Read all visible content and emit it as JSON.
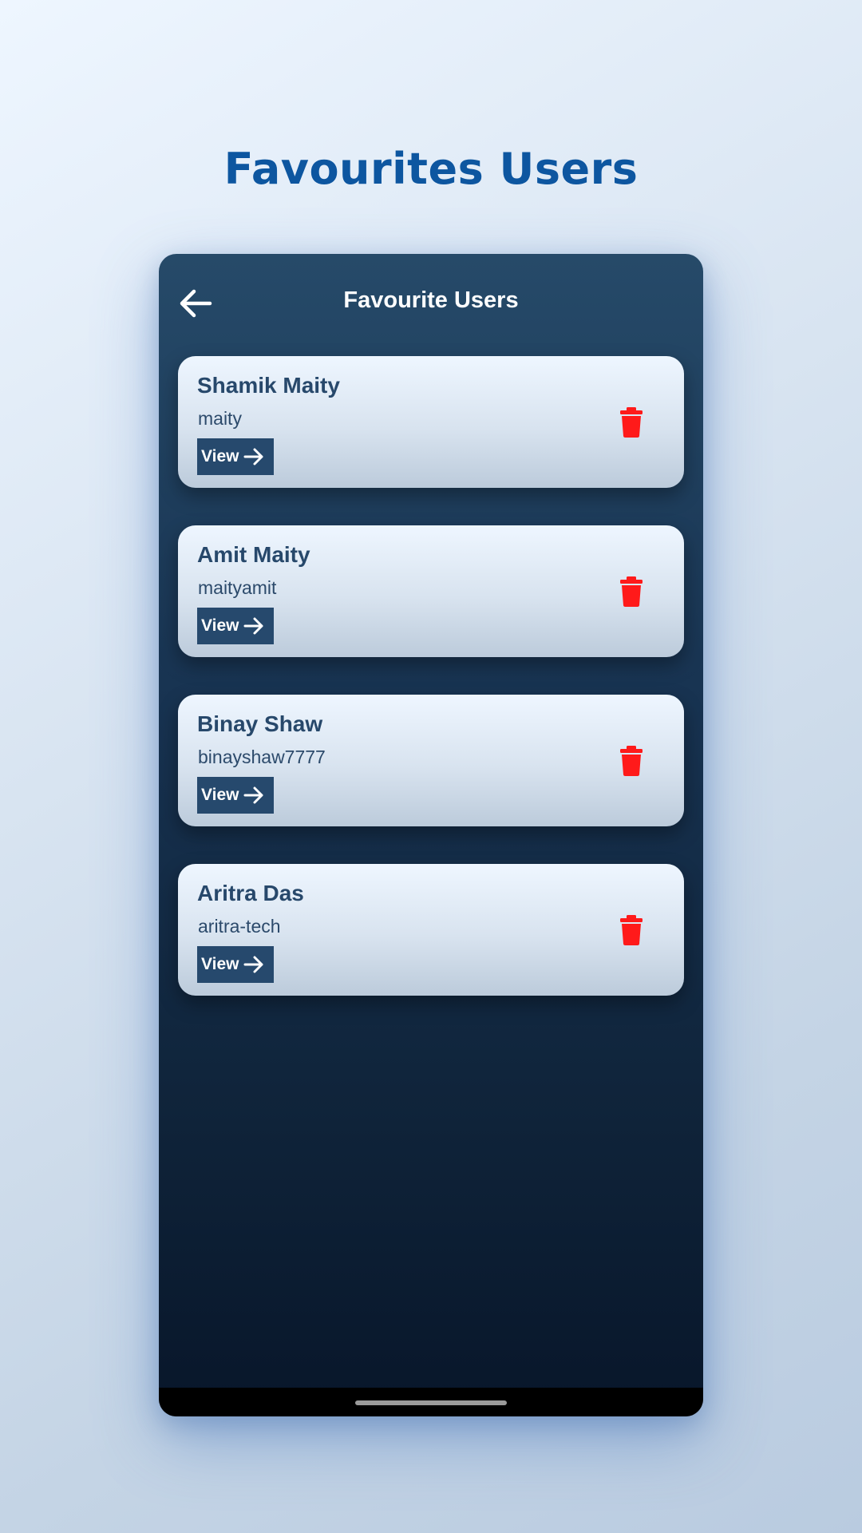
{
  "page_title": "Favourites Users",
  "appbar": {
    "title": "Favourite Users",
    "back_icon": "arrow-left-icon"
  },
  "users": [
    {
      "name": "Shamik Maity",
      "username": "maity",
      "view_label": "View"
    },
    {
      "name": "Amit Maity",
      "username": "maityamit",
      "view_label": "View"
    },
    {
      "name": "Binay Shaw",
      "username": "binayshaw7777",
      "view_label": "View"
    },
    {
      "name": "Aritra Das",
      "username": "aritra-tech",
      "view_label": "View"
    }
  ],
  "icons": {
    "view": "arrow-right-icon",
    "delete": "trash-icon"
  },
  "colors": {
    "title": "#0d56a0",
    "card_text": "#27486b",
    "view_button": "#26496d",
    "delete": "#ff1a1a"
  }
}
